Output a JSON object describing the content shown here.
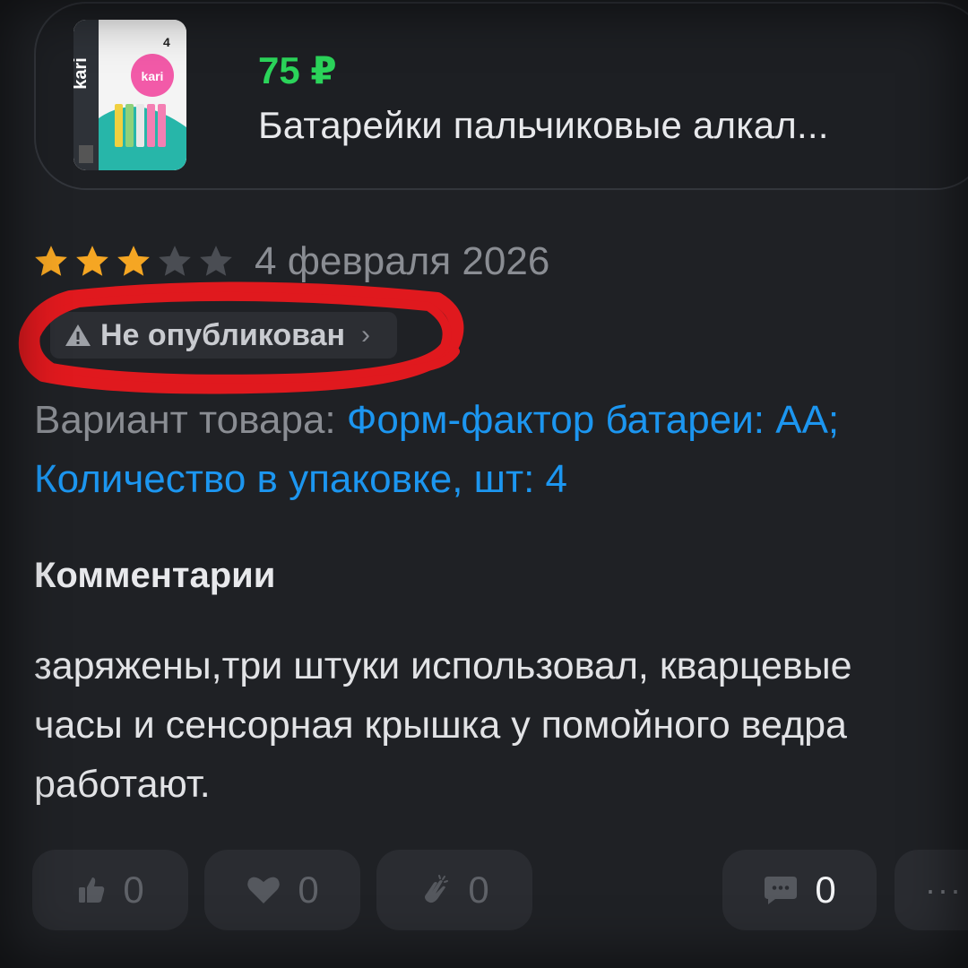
{
  "product": {
    "price": "75 ₽",
    "title": "Батарейки пальчиковые алкал...",
    "image_icon": "battery-pack-image",
    "price_color": "#2bd45a"
  },
  "review": {
    "rating": 3,
    "rating_max": 5,
    "date": "4 февраля 2026",
    "status": "Не опубликован",
    "status_icon": "warning-icon",
    "variant_label": "Вариант товара:",
    "variant_value": "Форм-фактор батареи: АА; Количество в упаковке, шт: 4"
  },
  "comments": {
    "heading": "Комментарии",
    "text": "заряжены,три штуки использовал, кварцевые часы и сенсорная крышка у помойного ведра работают."
  },
  "actions": {
    "like_count": "0",
    "heart_count": "0",
    "clap_count": "0",
    "comment_count": "0"
  },
  "colors": {
    "star_active": "#f5a623",
    "star_inactive": "#4a4d53",
    "link": "#1c96f0",
    "annotation": "#e0191e"
  }
}
